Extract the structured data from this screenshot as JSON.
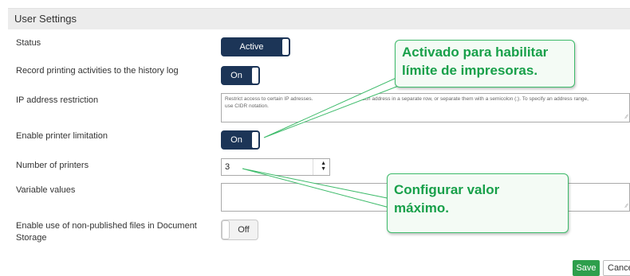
{
  "header": {
    "title": "User Settings"
  },
  "fields": {
    "status": {
      "label": "Status",
      "toggle": "Active",
      "state": "on"
    },
    "record_history": {
      "label": "Record printing activities to the history log",
      "toggle": "On",
      "state": "on"
    },
    "ip_restriction": {
      "label": "IP address restriction",
      "placeholder_part1": "Restrict access to certain IP adresses.",
      "placeholder_part2": "each address in a separate row, or separate them with a semicolon (;). To specify an address range,",
      "placeholder_line2": "use CIDR notation."
    },
    "printer_limitation": {
      "label": "Enable printer limitation",
      "toggle": "On",
      "state": "on"
    },
    "number_of_printers": {
      "label": "Number of printers",
      "value": "3"
    },
    "variable_values": {
      "label": "Variable values",
      "value": ""
    },
    "non_published": {
      "label_line1": "Enable use of non-published files in Document",
      "label_line2": "Storage",
      "toggle": "Off",
      "state": "off"
    }
  },
  "actions": {
    "save": "Save",
    "cancel": "Cance"
  },
  "callouts": {
    "top": {
      "line1": "Activado para habilitar",
      "line2": "límite de impresoras."
    },
    "bottom": {
      "line1": "Configurar valor",
      "line2": "máximo."
    }
  },
  "colors": {
    "toggle_on": "#1c3557",
    "save": "#2e9f4c",
    "callout_text": "#18a04a",
    "callout_border": "#3dbb6a"
  }
}
